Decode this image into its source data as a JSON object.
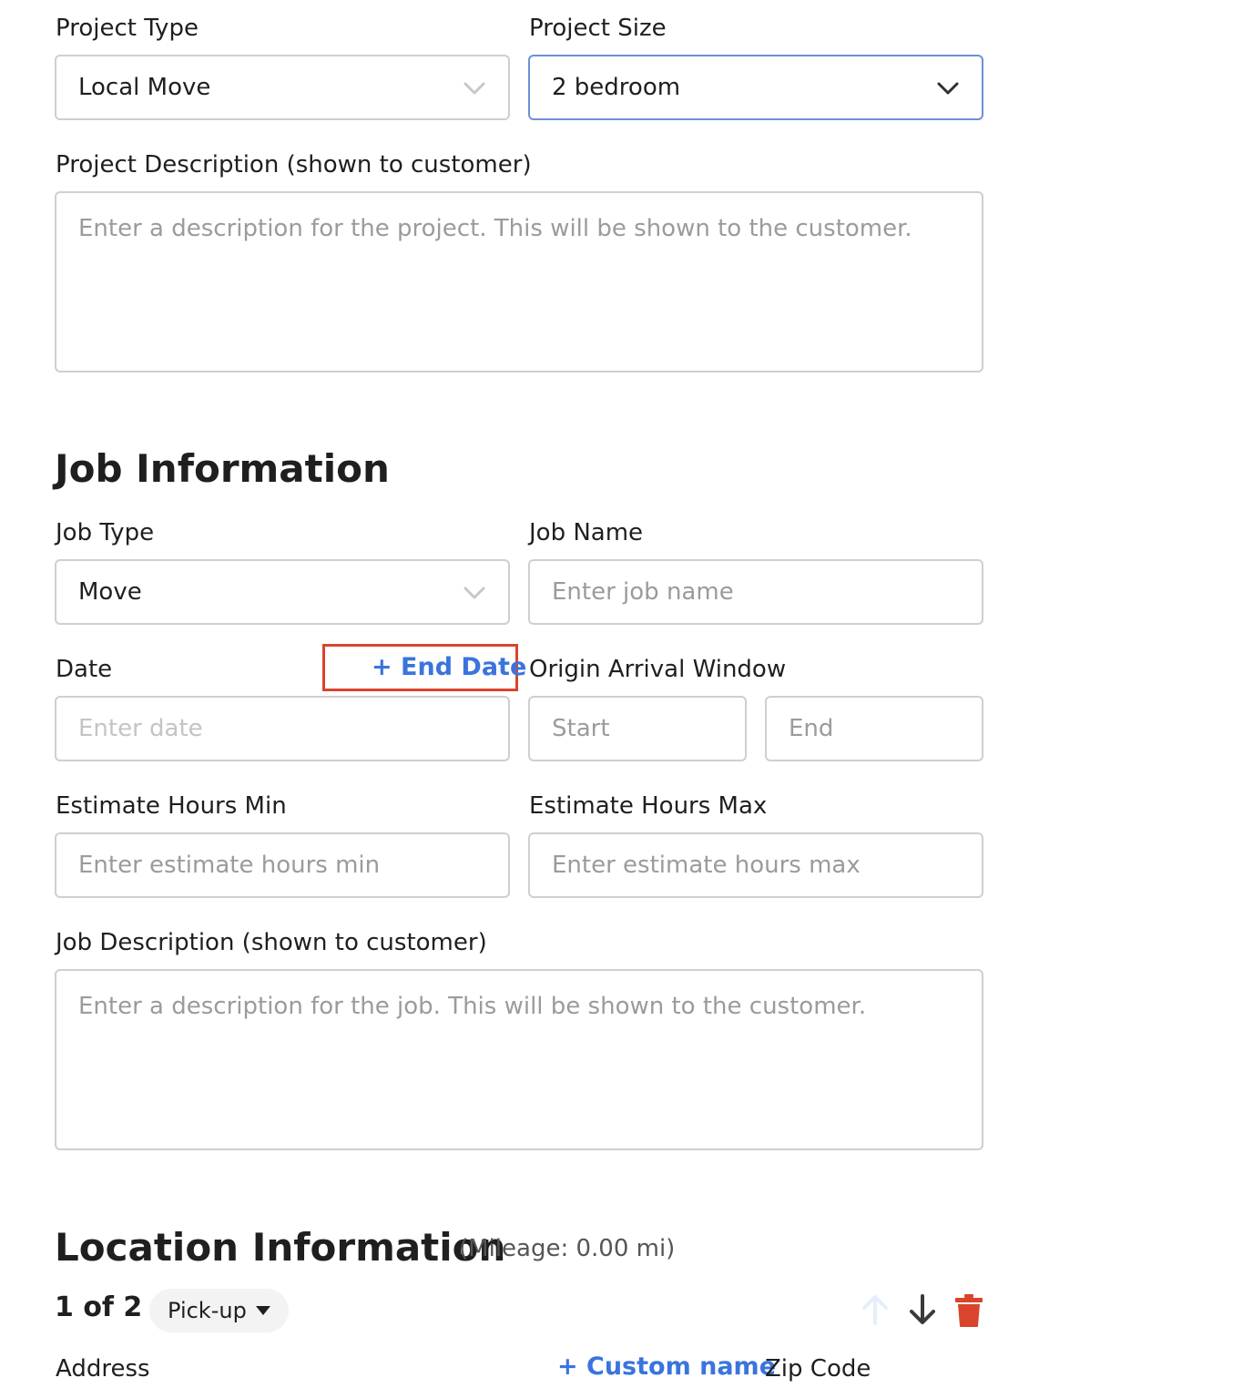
{
  "project": {
    "type_label": "Project Type",
    "type_value": "Local Move",
    "size_label": "Project Size",
    "size_value": "2 bedroom",
    "description_label": "Project Description (shown to customer)",
    "description_placeholder": "Enter a description for the project. This will be shown to the customer."
  },
  "job": {
    "heading": "Job Information",
    "type_label": "Job Type",
    "type_value": "Move",
    "name_label": "Job Name",
    "name_placeholder": "Enter job name",
    "date_label": "Date",
    "end_date_link": "+ End Date",
    "date_placeholder": "Enter date",
    "arrival_label": "Origin Arrival Window",
    "arrival_start_placeholder": "Start",
    "arrival_end_placeholder": "End",
    "hours_min_label": "Estimate Hours Min",
    "hours_min_placeholder": "Enter estimate hours min",
    "hours_max_label": "Estimate Hours Max",
    "hours_max_placeholder": "Enter estimate hours max",
    "description_label": "Job Description (shown to customer)",
    "description_placeholder": "Enter a description for the job. This will be shown to the customer."
  },
  "location": {
    "heading": "Location Information",
    "mileage": "(Mileage: 0.00 mi)",
    "counter": "1 of 2",
    "stop_type": "Pick-up",
    "address_label": "Address",
    "custom_name_link": "+ Custom name",
    "zip_label": "Zip Code"
  },
  "colors": {
    "accent": "#3a74dd",
    "focus_border": "#6f8fd6",
    "highlight": "#d9452c",
    "delete": "#d9452c"
  },
  "icons": {
    "select_chevron": "chevron-down-icon",
    "move_up": "arrow-up-icon",
    "move_down": "arrow-down-icon",
    "delete": "trash-icon",
    "dropdown_caret": "caret-down-icon"
  }
}
